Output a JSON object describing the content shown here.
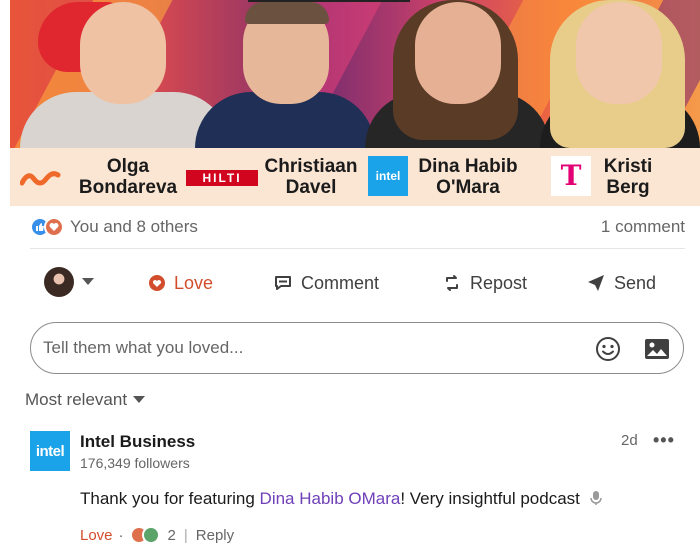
{
  "banner": {
    "people": [
      {
        "first": "Olga",
        "last": "Bondareva",
        "logo": "orange-wave-logo",
        "logo_text": ""
      },
      {
        "first": "Christiaan",
        "last": "Davel",
        "logo": "hilti-logo",
        "logo_text": "HILTI"
      },
      {
        "first": "Dina Habib",
        "last": "O'Mara",
        "logo": "intel-logo",
        "logo_text": "intel"
      },
      {
        "first": "Kristi",
        "last": "Berg",
        "logo": "t-mobile-logo",
        "logo_text": "T"
      }
    ]
  },
  "social": {
    "reactions_text": "You and 8 others",
    "comments_text": "1 comment",
    "reaction_icons": [
      "like-icon",
      "love-icon"
    ]
  },
  "actions": {
    "love": "Love",
    "comment": "Comment",
    "repost": "Repost",
    "send": "Send"
  },
  "comment_box": {
    "placeholder": "Tell them what you loved..."
  },
  "sort": {
    "label": "Most relevant"
  },
  "comment": {
    "logo_text": "intel",
    "author": "Intel Business",
    "followers": "176,349 followers",
    "time": "2d",
    "text_before": "Thank you for featuring ",
    "mention": "Dina Habib OMara",
    "text_after": "! Very insightful podcast",
    "love_label": "Love",
    "reaction_count": "2",
    "reply_label": "Reply"
  },
  "colors": {
    "love": "#d24d2c",
    "mention": "#6f40b8",
    "intel_blue": "#1aa3e8",
    "hilti_red": "#d2051e",
    "tmobile_magenta": "#e20074",
    "names_bg": "#fbe5d3"
  }
}
